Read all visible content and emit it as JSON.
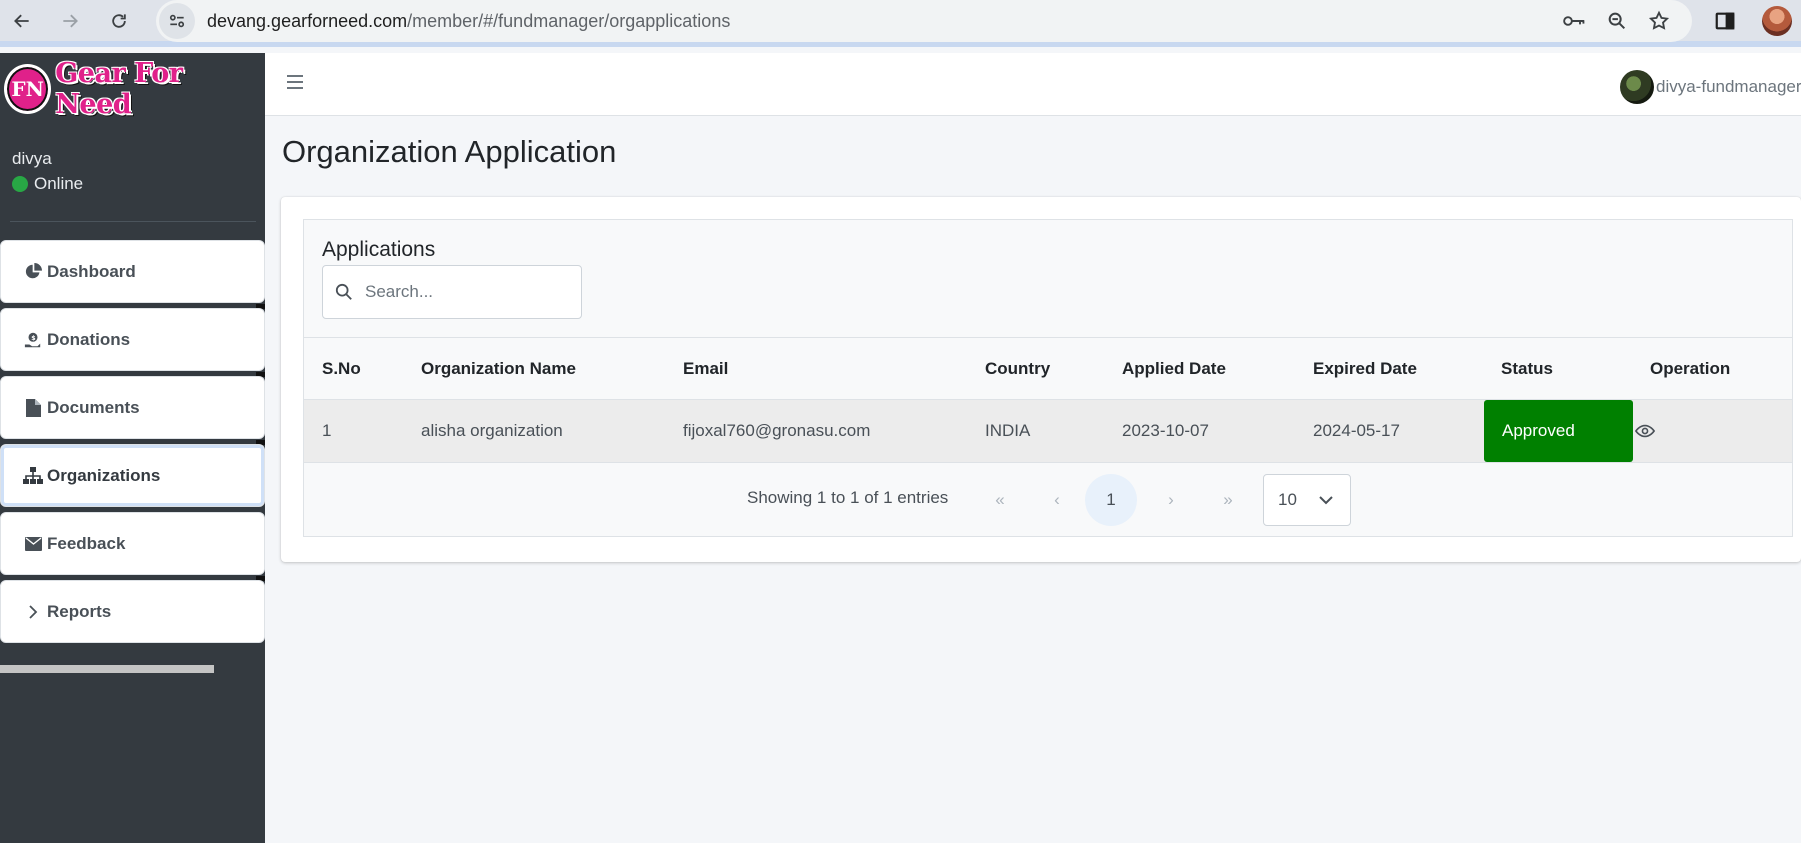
{
  "browser": {
    "url_host": "devang.gearforneed.com",
    "url_path": "/member/#/fundmanager/orgapplications"
  },
  "brand": {
    "logo_text": "Gear For Need",
    "badge_text": "FN"
  },
  "user_panel": {
    "name": "divya",
    "status": "Online"
  },
  "sidebar": {
    "items": [
      {
        "label": "Dashboard",
        "icon": "pie-chart-icon"
      },
      {
        "label": "Donations",
        "icon": "hand-holding-dollar-icon"
      },
      {
        "label": "Documents",
        "icon": "file-icon"
      },
      {
        "label": "Organizations",
        "icon": "sitemap-icon",
        "active": true
      },
      {
        "label": "Feedback",
        "icon": "envelope-icon"
      },
      {
        "label": "Reports",
        "icon": "chevron-right-icon"
      }
    ]
  },
  "header": {
    "user_label": "divya-fundmanager"
  },
  "page": {
    "title": "Organization Application"
  },
  "applications": {
    "section_title": "Applications",
    "search_placeholder": "Search...",
    "columns": [
      "S.No",
      "Organization Name",
      "Email",
      "Country",
      "Applied Date",
      "Expired Date",
      "Status",
      "Operation"
    ],
    "rows": [
      {
        "sno": "1",
        "organization_name": "alisha organization",
        "email": "fijoxal760@gronasu.com",
        "country": "INDIA",
        "applied_date": "2023-10-07",
        "expired_date": "2024-05-17",
        "status": "Approved",
        "status_color": "#008000"
      }
    ],
    "pagination": {
      "showing_text": "Showing 1 to 1 of 1 entries",
      "first": "«",
      "prev": "‹",
      "current_page": "1",
      "next": "›",
      "last": "»",
      "per_page": "10"
    }
  },
  "colors": {
    "sidebar_bg": "#343a40",
    "accent_pink": "#e0218a",
    "status_online": "#28a745"
  }
}
